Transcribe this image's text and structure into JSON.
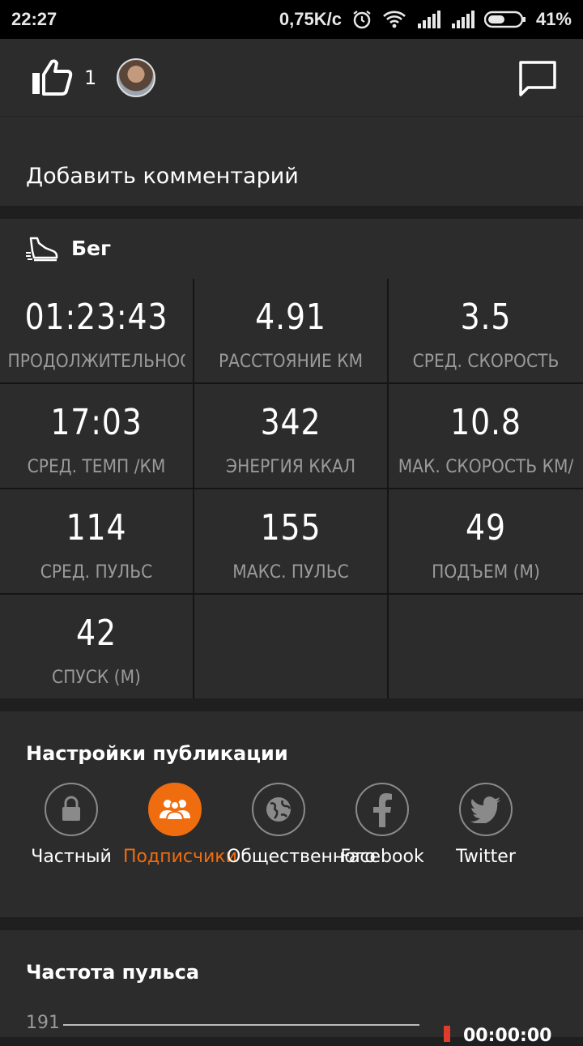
{
  "status_bar": {
    "time": "22:27",
    "network_speed": "0,75K/c",
    "battery_percent": "41%",
    "icons": [
      "alarm-icon",
      "wifi-icon",
      "signal-icon",
      "signal-icon",
      "battery-icon"
    ]
  },
  "social": {
    "like_count": "1",
    "icons": [
      "thumbs-up-icon",
      "avatar",
      "comment-icon"
    ]
  },
  "comment": {
    "add_label": "Добавить комментарий"
  },
  "activity": {
    "type_label": "Бег",
    "icon": "running-shoe-icon"
  },
  "stats": [
    {
      "value": "01:23:43",
      "label": "ПРОДОЛЖИТЕЛЬНОСТЬ"
    },
    {
      "value": "4.91",
      "label": "РАССТОЯНИЕ КМ"
    },
    {
      "value": "3.5",
      "label": "СРЕД. СКОРОСТЬ КМ/Ч"
    },
    {
      "value": "17:03",
      "label": "СРЕД. ТЕМП /КМ"
    },
    {
      "value": "342",
      "label": "ЭНЕРГИЯ ККАЛ"
    },
    {
      "value": "10.8",
      "label": "МАК. СКОРОСТЬ КМ/Ч"
    },
    {
      "value": "114",
      "label": "СРЕД. ПУЛЬС"
    },
    {
      "value": "155",
      "label": "МАКС. ПУЛЬС"
    },
    {
      "value": "49",
      "label": "ПОДЪЕМ (М)"
    },
    {
      "value": "42",
      "label": "СПУСК (М)"
    }
  ],
  "publication": {
    "title": "Настройки публикации",
    "options": [
      {
        "label": "Частный",
        "icon": "lock-icon",
        "selected": false
      },
      {
        "label": "Подписчики",
        "icon": "followers-icon",
        "selected": true
      },
      {
        "label": "Общественного",
        "icon": "globe-icon",
        "selected": false
      },
      {
        "label": "Facebook",
        "icon": "facebook-icon",
        "selected": false
      },
      {
        "label": "Twitter",
        "icon": "twitter-icon",
        "selected": false
      }
    ],
    "accent_color": "#f06d0f"
  },
  "heart_rate": {
    "title": "Частота пульса",
    "axis_max": "191",
    "time_label": "00:00:00"
  }
}
